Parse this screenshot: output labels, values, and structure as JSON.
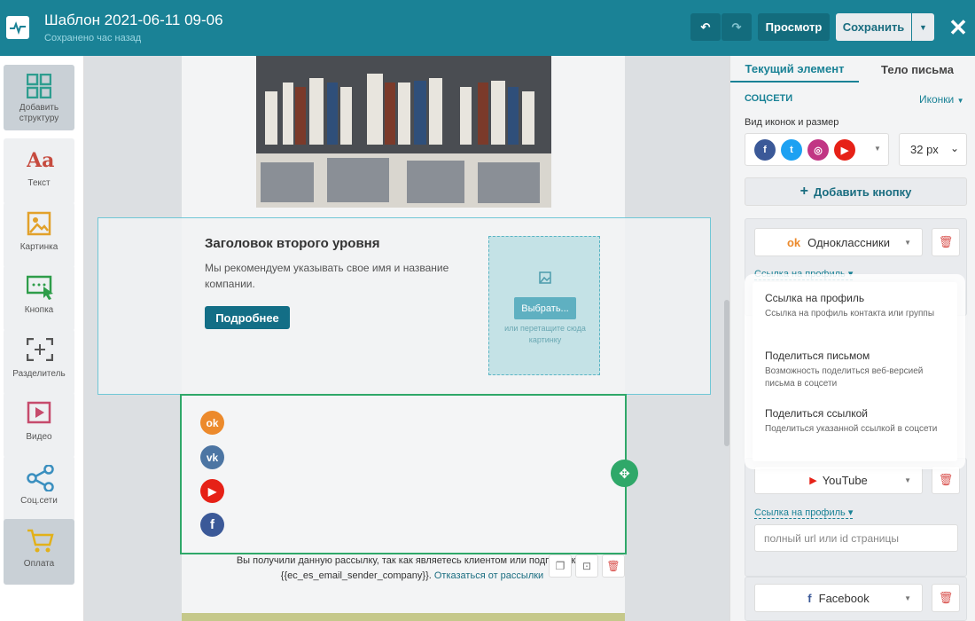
{
  "topbar": {
    "title": "Шаблон 2021-06-11 09-06",
    "subtitle": "Сохранено час назад",
    "preview_label": "Просмотр",
    "save_label": "Сохранить"
  },
  "toolbar": {
    "items": [
      {
        "label": "Добавить структуру",
        "icon": "grid-icon"
      },
      {
        "label": "Текст",
        "icon": "text-icon"
      },
      {
        "label": "Картинка",
        "icon": "image-icon"
      },
      {
        "label": "Кнопка",
        "icon": "button-icon"
      },
      {
        "label": "Разделитель",
        "icon": "divider-icon"
      },
      {
        "label": "Видео",
        "icon": "video-icon"
      },
      {
        "label": "Соц.сети",
        "icon": "share-icon"
      },
      {
        "label": "Оплата",
        "icon": "cart-icon"
      }
    ]
  },
  "canvas": {
    "heading": "Заголовок второго уровня",
    "text": "Мы рекомендуем указывать свое имя и название компании.",
    "more_label": "Подробнее",
    "choose_label": "Выбрать...",
    "drop_hint": "или перетащите сюда картинку",
    "footer_text": "Вы получили данную рассылку, так как являетесь клиентом или подписчиком",
    "footer_var": "{{ec_es_email_sender_company}}.",
    "unsubscribe": "Отказаться от рассылки"
  },
  "panel": {
    "tab_current": "Текущий элемент",
    "tab_body": "Тело письма",
    "section_title": "СОЦСЕТИ",
    "icons_menu": "Иконки",
    "icon_style_label": "Вид иконок и размер",
    "size_value": "32 px",
    "add_button_label": "Добавить кнопку",
    "networks": [
      {
        "name": "Одноклассники",
        "link_label": "Ссылка на профиль"
      },
      {
        "name": "YouTube",
        "link_label": "Ссылка на профиль"
      },
      {
        "name": "Facebook"
      }
    ],
    "url_placeholder": "полный url или id страницы"
  },
  "dropdown": {
    "options": [
      {
        "title": "Ссылка на профиль",
        "desc": "Ссылка на профиль контакта или группы"
      },
      {
        "title": "Поделиться письмом",
        "desc": "Возможность поделиться веб-версией письма в соцсети"
      },
      {
        "title": "Поделиться ссылкой",
        "desc": "Поделиться указанной ссылкой в соцсети"
      }
    ]
  },
  "colors": {
    "topbar": "#1a8296",
    "accent_green": "#2fa869",
    "odnoklassniki": "#ec8a2c",
    "vk": "#4c75a3",
    "youtube": "#e62117",
    "facebook": "#3b5998",
    "instagram": "#c13584",
    "twitter": "#1da1f2"
  }
}
